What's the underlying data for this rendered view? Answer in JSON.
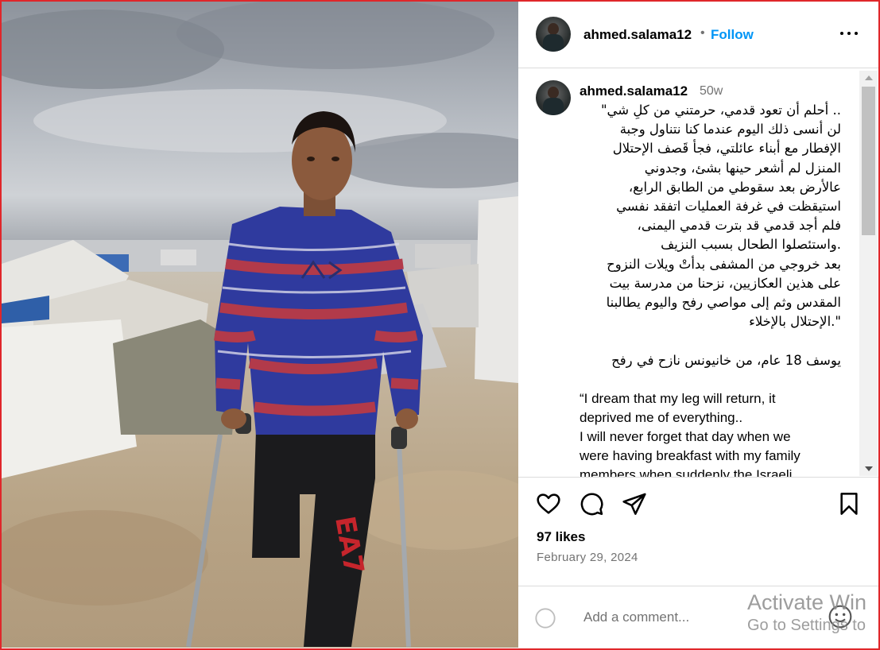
{
  "post": {
    "username": "ahmed.salama12",
    "follow_label": "Follow",
    "time_ago": "50w",
    "caption_arabic": ".. أحلم أن تعود قدمي، حرمتني من كلِ شي\"\nلن أنسى ذلك اليوم عندما كنا نتناول وجبة\nالإفطار مع أبناء عائلتي، فجأ قَصف الإحتلال\nالمنزل لم أشعر حينها بشئ، وجدوني\nعالأرض بعد سقوطي من الطابق الرابع،\nاستيقظت في غرفة العمليات اتفقد نفسي\nفلم أجد قدمي قد بترت قدمي اليمنى،\n.واستئصلوا الطحال بسبب النزيف\nبعد خروجي من المشفى بدأتْ ويلات النزوح\nعلى هذين العكازيين، نزحنا من مدرسة بيت\nالمقدس وثم إلى مواصي رفح واليوم يطالبنا\n\".الإحتلال بالإخلاء",
    "caption_arabic_sig": "يوسف 18 عام، من خانيونس نازح في رفح",
    "caption_english": "“I dream that my leg will return, it\ndeprived me of everything..\nI will never forget that day when we\nwere having breakfast with my family\nmembers when suddenly the Israeli",
    "likes": "97 likes",
    "date": "February 29, 2024",
    "comment_placeholder": "Add a comment..."
  },
  "icons": {
    "more": "more-options-icon",
    "like": "heart-icon",
    "comment": "comment-bubble-icon",
    "share": "paper-plane-icon",
    "save": "bookmark-icon",
    "emoji": "emoji-smiley-icon"
  },
  "colors": {
    "follow": "#0095f6",
    "secondary_text": "#737373",
    "border": "#dbdbdb",
    "frame": "#e0262a"
  },
  "watermark": {
    "line1": "Activate Win",
    "line2": "Go to Settings to"
  }
}
